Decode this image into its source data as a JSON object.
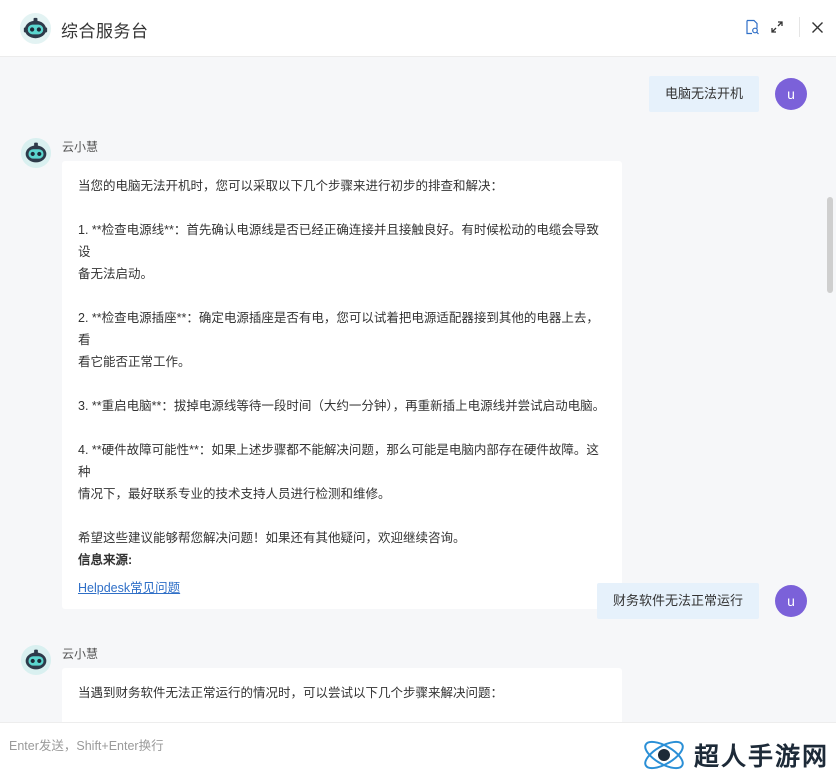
{
  "header": {
    "title": "综合服务台",
    "icons": [
      "logo-robot-icon",
      "document-search-icon",
      "expand-icon",
      "close-icon"
    ],
    "accent": "#2f6fc7"
  },
  "messages": {
    "user1": {
      "text": "电脑无法开机",
      "avatar": "u"
    },
    "bot1": {
      "name": "云小慧",
      "intro": "当您的电脑无法开机时，您可以采取以下几个步骤来进行初步的排查和解决：",
      "step1a": "1. **检查电源线**：首先确认电源线是否已经正确连接并且接触良好。有时候松动的电缆会导致设",
      "step1b": "备无法启动。",
      "step2a": "2. **检查电源插座**：确定电源插座是否有电，您可以试着把电源适配器接到其他的电器上去，看",
      "step2b": "看它能否正常工作。",
      "step3": "3. **重启电脑**：拔掉电源线等待一段时间（大约一分钟），再重新插上电源线并尝试启动电脑。",
      "step4a": "4. **硬件故障可能性**：如果上述步骤都不能解决问题，那么可能是电脑内部存在硬件故障。这种",
      "step4b": "情况下，最好联系专业的技术支持人员进行检测和维修。",
      "closing": "希望这些建议能够帮您解决问题！如果还有其他疑问，欢迎继续咨询。",
      "source_title": "信息来源:",
      "source_link": "Helpdesk常见问题"
    },
    "user2": {
      "text": "财务软件无法正常运行",
      "avatar": "u"
    },
    "bot2": {
      "name": "云小慧",
      "intro": "当遇到财务软件无法正常运行的情况时，可以尝试以下几个步骤来解决问题："
    }
  },
  "input": {
    "placeholder": "Enter发送，Shift+Enter换行"
  },
  "watermark": {
    "text": "超人手游网"
  },
  "colors": {
    "user_avatar": "#7b61d9",
    "user_bubble": "#e6f1fb",
    "background": "#f6f7f9"
  }
}
